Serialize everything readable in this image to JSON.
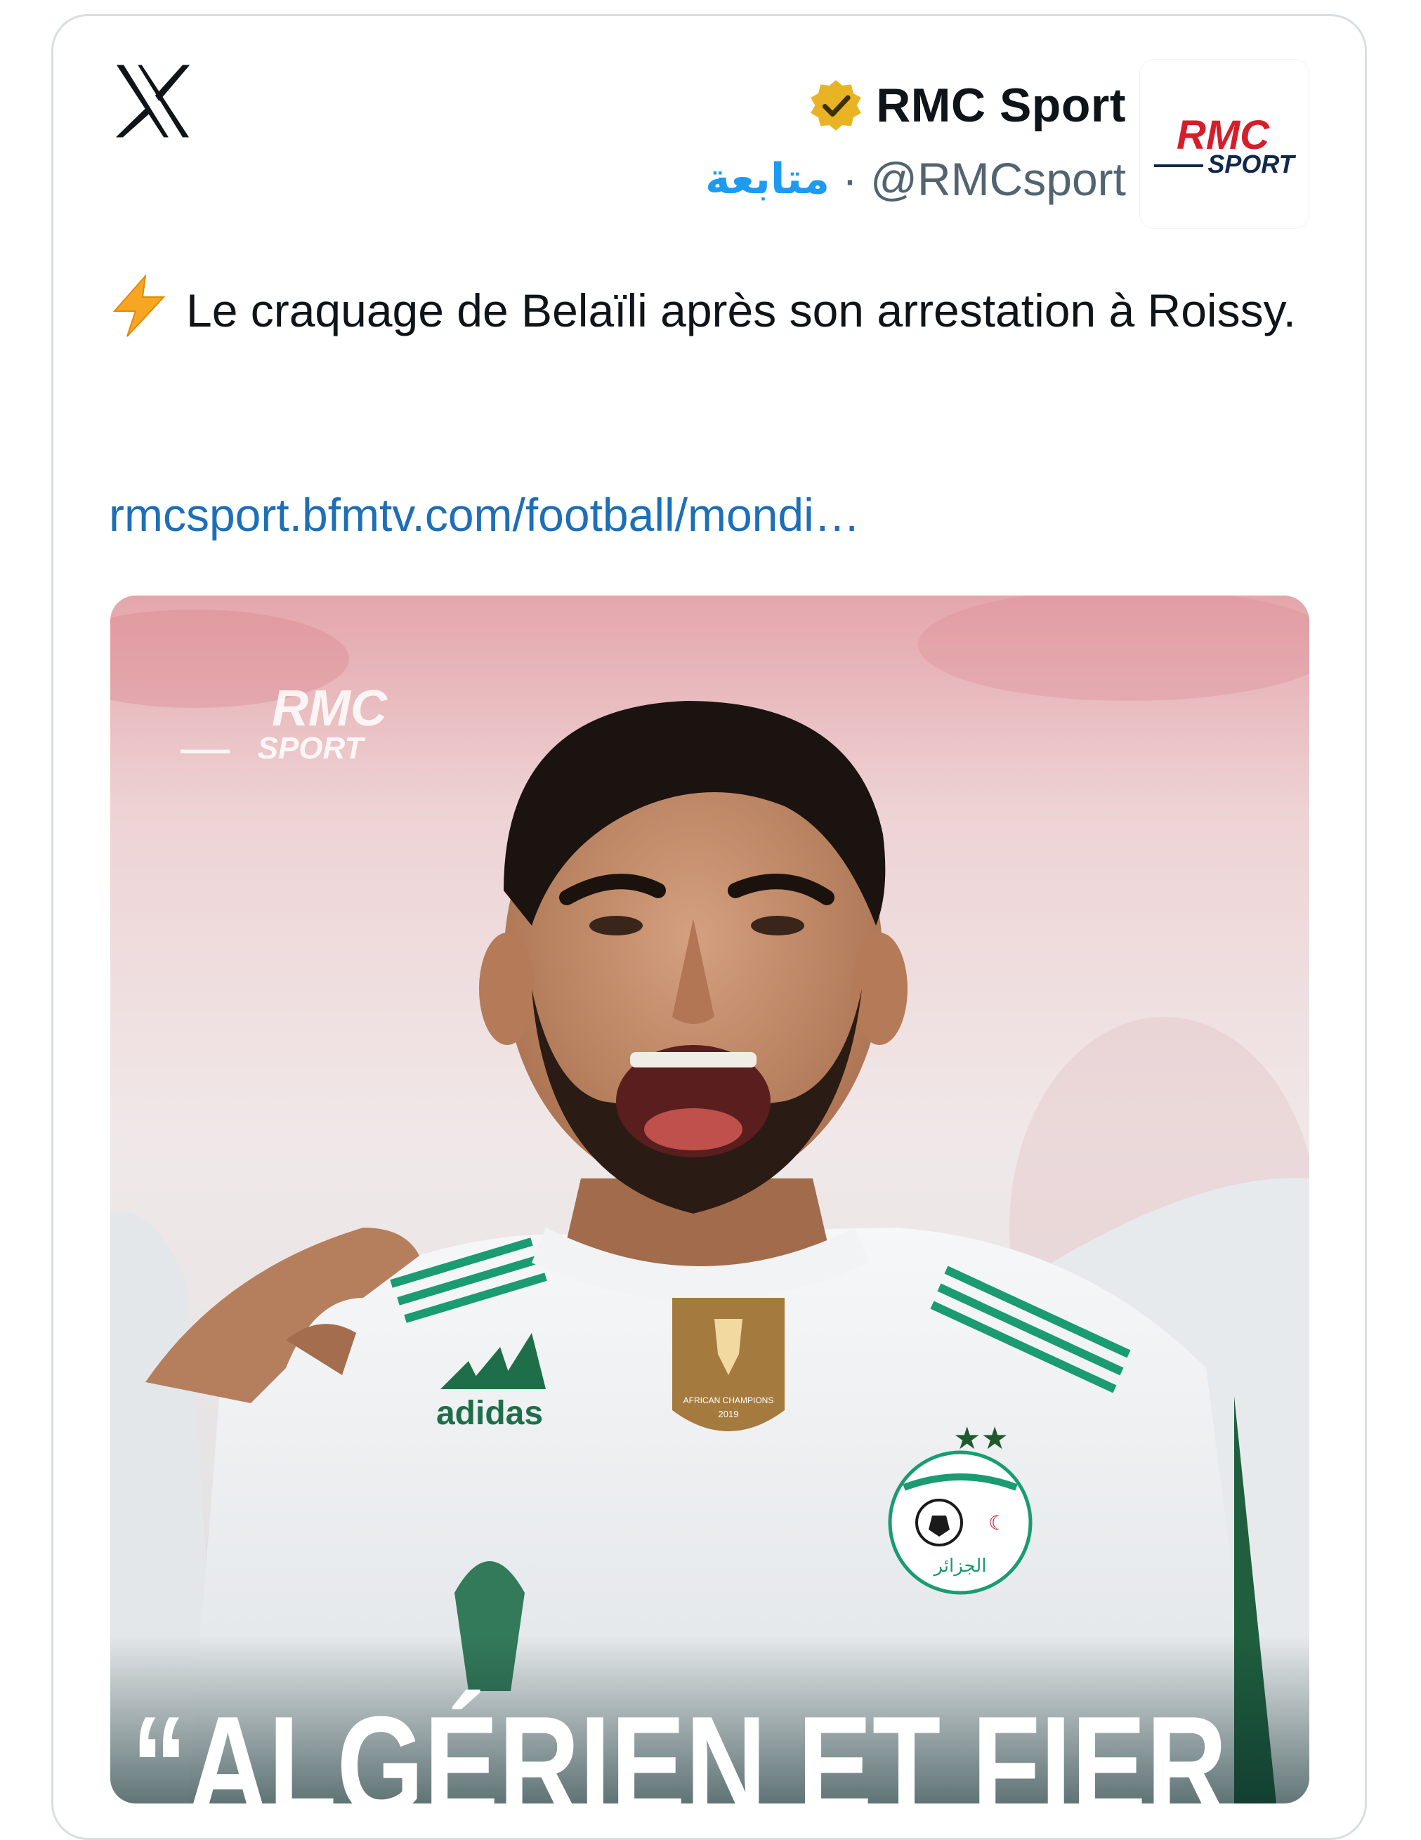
{
  "tweet": {
    "platform_icon": "x-logo-icon",
    "author": {
      "display_name": "RMC Sport",
      "verified_icon": "gold-verified-badge-icon",
      "handle": "@RMCsport",
      "separator": "·",
      "follow_label": "متابعة",
      "avatar": {
        "icon": "rmc-sport-logo",
        "logo_line1": "RMC",
        "logo_line2": "SPORT"
      }
    },
    "text_icon": "lightning-bolt-icon",
    "text": "Le craquage de Belaïli après son arrestation à Roissy.",
    "link": "rmcsport.bfmtv.com/football/mondi…",
    "media": {
      "watermark_line1": "RMC",
      "watermark_line2": "SPORT",
      "kit_brand": "adidas",
      "badge_text_1": "AFRICAN CHAMPIONS",
      "badge_text_2": "2019",
      "crest_text": "الجزائر",
      "headline": "“ALGÉRIEN ET FIER"
    }
  },
  "colors": {
    "text_primary": "#0f1419",
    "text_secondary": "#536471",
    "follow_blue": "#1d9bf0",
    "link_blue": "#1d6fb8",
    "rmc_red": "#d41f2b",
    "rmc_navy": "#12284c",
    "verified_gold": "#e8b423",
    "jersey_green": "#1a9b72"
  }
}
